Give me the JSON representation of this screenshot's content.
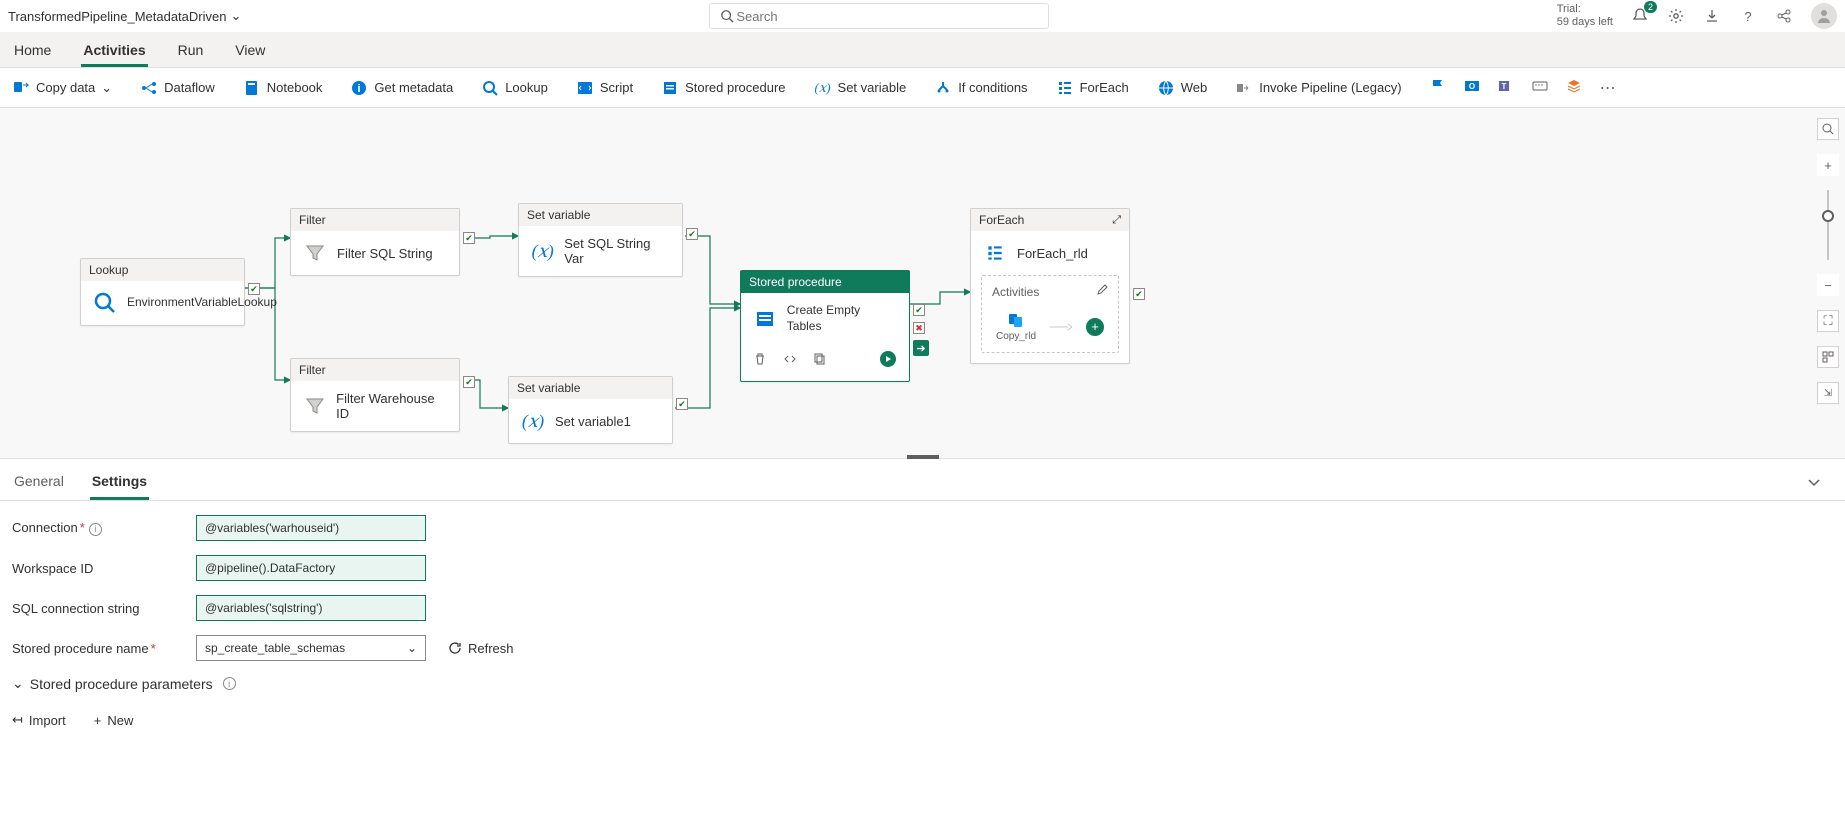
{
  "header": {
    "pipeline_name": "TransformedPipeline_MetadataDriven",
    "search_placeholder": "Search",
    "trial_label": "Trial:",
    "trial_days": "59 days left",
    "notification_count": "2"
  },
  "nav1": {
    "tabs": [
      "Home",
      "Activities",
      "Run",
      "View"
    ],
    "active_index": 1
  },
  "toolbar": {
    "items": [
      {
        "label": "Copy data",
        "icon": "copy-data-icon",
        "color": "#0078d4",
        "dropdown": true
      },
      {
        "label": "Dataflow",
        "icon": "dataflow-icon",
        "color": "#0078d4"
      },
      {
        "label": "Notebook",
        "icon": "notebook-icon",
        "color": "#0078d4"
      },
      {
        "label": "Get metadata",
        "icon": "info-icon",
        "color": "#0078d4"
      },
      {
        "label": "Lookup",
        "icon": "lookup-icon",
        "color": "#0078d4"
      },
      {
        "label": "Script",
        "icon": "script-icon",
        "color": "#0078d4"
      },
      {
        "label": "Stored procedure",
        "icon": "stored-proc-icon",
        "color": "#0078d4"
      },
      {
        "label": "Set variable",
        "icon": "set-var-icon",
        "color": "#0078d4"
      },
      {
        "label": "If conditions",
        "icon": "if-icon",
        "color": "#0078d4"
      },
      {
        "label": "ForEach",
        "icon": "foreach-icon",
        "color": "#0078d4"
      },
      {
        "label": "Web",
        "icon": "web-icon",
        "color": "#0078d4"
      },
      {
        "label": "Invoke Pipeline (Legacy)",
        "icon": "invoke-icon",
        "color": "#605e5c"
      }
    ]
  },
  "nodes": {
    "lookup": {
      "type": "Lookup",
      "name": "EnvironmentVariableLookup"
    },
    "filter1": {
      "type": "Filter",
      "name": "Filter SQL String"
    },
    "filter2": {
      "type": "Filter",
      "name": "Filter Warehouse ID"
    },
    "setvar1": {
      "type": "Set variable",
      "name": "Set SQL String Var"
    },
    "setvar2": {
      "type": "Set variable",
      "name": "Set variable1"
    },
    "sproc": {
      "type": "Stored procedure",
      "name": "Create Empty Tables"
    },
    "foreach": {
      "type": "ForEach",
      "name": "ForEach_rld",
      "sub_label": "Activities",
      "mini": "Copy_rld"
    }
  },
  "panel": {
    "tabs": [
      "General",
      "Settings"
    ],
    "active_index": 1,
    "fields": {
      "connection": {
        "label": "Connection",
        "value": "@variables('warhouseid')"
      },
      "workspace": {
        "label": "Workspace ID",
        "value": "@pipeline().DataFactory"
      },
      "sqlconn": {
        "label": "SQL connection string",
        "value": "@variables('sqlstring')"
      },
      "spname": {
        "label": "Stored procedure name",
        "value": "sp_create_table_schemas"
      },
      "refresh": "Refresh",
      "sp_params": "Stored procedure parameters"
    },
    "footer": {
      "import": "Import",
      "new": "New"
    }
  }
}
